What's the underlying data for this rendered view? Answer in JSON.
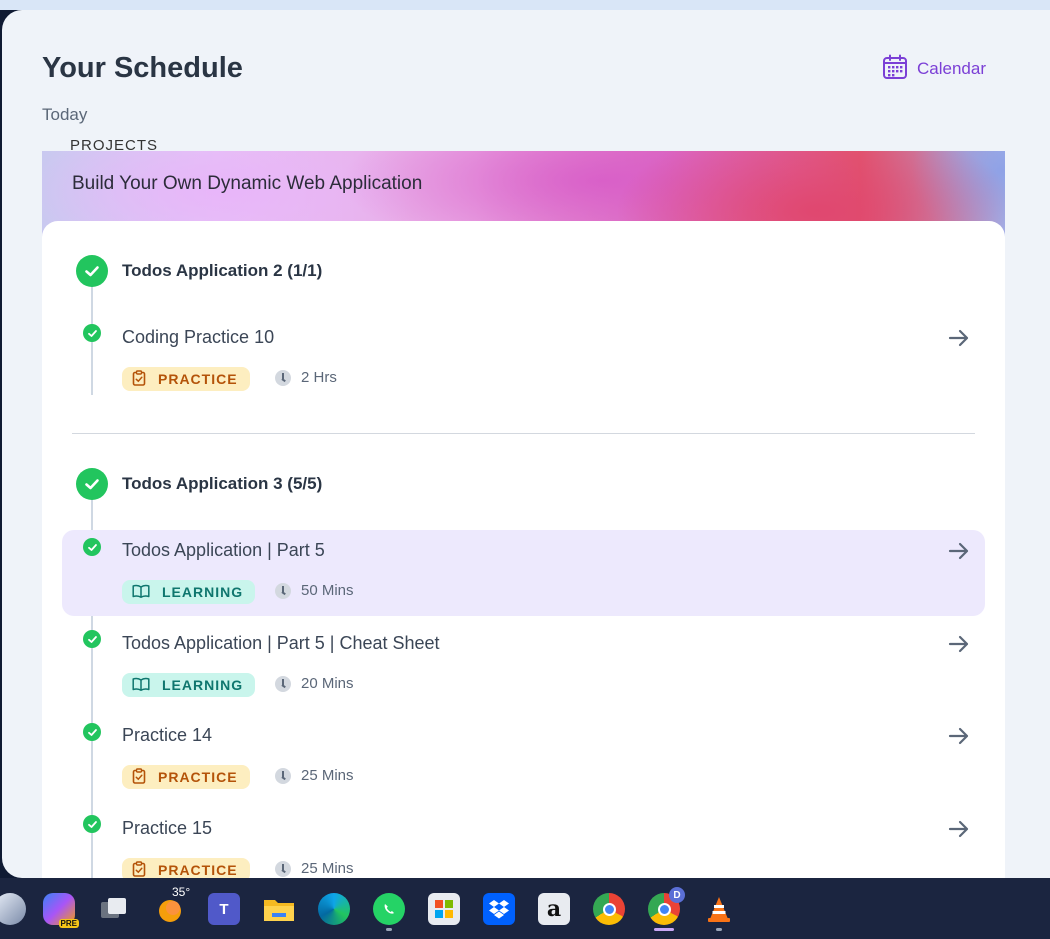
{
  "header": {
    "title": "Your Schedule",
    "subtitle": "Today",
    "calendar_label": "Calendar"
  },
  "banner": {
    "category_cut": "PROJECTS",
    "title": "Build Your Own Dynamic Web Application"
  },
  "groups": [
    {
      "title": "Todos Application 2 (1/1)",
      "items": [
        {
          "title": "Coding Practice 10",
          "tag": "PRACTICE",
          "duration": "2 Hrs"
        }
      ]
    },
    {
      "title": "Todos Application 3 (5/5)",
      "items": [
        {
          "title": "Todos Application | Part 5",
          "tag": "LEARNING",
          "duration": "50 Mins"
        },
        {
          "title": "Todos Application | Part 5 | Cheat Sheet",
          "tag": "LEARNING",
          "duration": "20 Mins"
        },
        {
          "title": "Practice 14",
          "tag": "PRACTICE",
          "duration": "25 Mins"
        },
        {
          "title": "Practice 15",
          "tag": "PRACTICE",
          "duration": "25 Mins"
        }
      ]
    }
  ],
  "taskbar": {
    "weather_temp": "35°",
    "copilot_badge": "PRE",
    "profile_badge": "D"
  },
  "colors": {
    "accent": "#7b3fd6",
    "success": "#22c55e",
    "practice_bg": "#fdeec0",
    "practice_fg": "#b45309",
    "learning_bg": "#c9f5ec",
    "learning_fg": "#0f766e",
    "active_row": "#ede9fd"
  }
}
